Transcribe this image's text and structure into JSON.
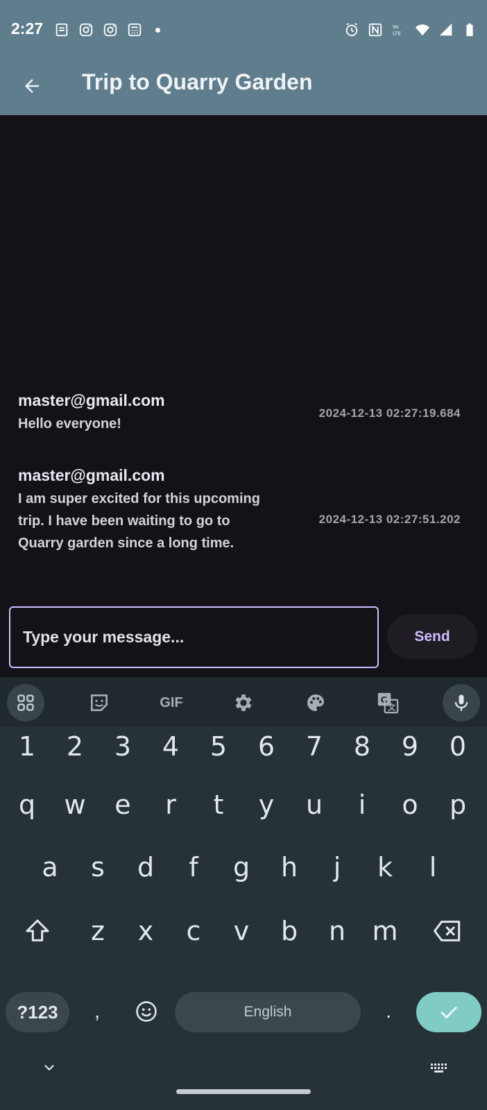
{
  "status_bar": {
    "time": "2:27",
    "left_icons": [
      "notes-icon",
      "instagram-icon",
      "instagram-icon",
      "calculator-icon",
      "dot-icon"
    ],
    "right_icons": [
      "alarm-icon",
      "nfc-icon",
      "volte-icon",
      "wifi-icon",
      "signal-icon",
      "battery-icon"
    ]
  },
  "app_bar": {
    "title": "Trip to Quarry Garden",
    "back_icon": "arrow-back-icon"
  },
  "messages": [
    {
      "sender": "master@gmail.com",
      "text": "Hello everyone!",
      "timestamp": "2024-12-13 02:27:19.684"
    },
    {
      "sender": "master@gmail.com",
      "text": "I am super excited for this upcoming trip. I have been waiting to go to Quarry garden since a long time.",
      "timestamp": "2024-12-13 02:27:51.202"
    }
  ],
  "composer": {
    "placeholder": "Type your message...",
    "value": "",
    "send_label": "Send"
  },
  "keyboard": {
    "toolbar": [
      "apps-icon",
      "sticker-icon",
      "GIF",
      "settings-icon",
      "palette-icon",
      "translate-icon",
      "mic-icon"
    ],
    "row_numbers": [
      "1",
      "2",
      "3",
      "4",
      "5",
      "6",
      "7",
      "8",
      "9",
      "0"
    ],
    "row_1": [
      "q",
      "w",
      "e",
      "r",
      "t",
      "y",
      "u",
      "i",
      "o",
      "p"
    ],
    "row_2": [
      "a",
      "s",
      "d",
      "f",
      "g",
      "h",
      "j",
      "k",
      "l"
    ],
    "row_3": [
      "z",
      "x",
      "c",
      "v",
      "b",
      "n",
      "m"
    ],
    "symbols_label": "?123",
    "comma": ",",
    "space_label": "English",
    "period": ".",
    "colors": {
      "enter": "#80cbc4",
      "background": "#263238"
    }
  },
  "colors": {
    "app_bar": "#5f7d8c",
    "chat_bg": "#141218",
    "accent": "#cfbcff"
  }
}
